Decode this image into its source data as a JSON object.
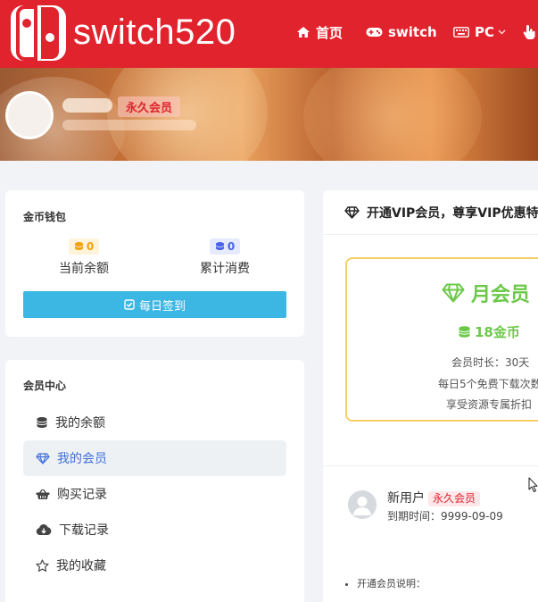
{
  "colors": {
    "brand": "#e1232e",
    "checkin": "#3cb6e3",
    "vip_green": "#6cc84a",
    "vip_border": "#f6cf64",
    "badge_red": "#e02330",
    "active_blue": "#3f6fd8"
  },
  "header": {
    "logo_text": "switch520",
    "nav": [
      {
        "label": "首页",
        "icon": "home-icon"
      },
      {
        "label": "switch",
        "icon": "gamepad-icon"
      },
      {
        "label": "PC",
        "icon": "keyboard-icon"
      }
    ]
  },
  "banner": {
    "badge": "永久会员"
  },
  "wallet": {
    "title": "金币钱包",
    "balance_value": "0",
    "balance_label": "当前余额",
    "spent_value": "0",
    "spent_label": "累计消费",
    "checkin_label": "每日签到"
  },
  "member_center": {
    "title": "会员中心",
    "items": [
      {
        "label": "我的余额",
        "icon": "coins-icon"
      },
      {
        "label": "我的会员",
        "icon": "diamond-icon"
      },
      {
        "label": "购买记录",
        "icon": "basket-icon"
      },
      {
        "label": "下载记录",
        "icon": "cloud-download-icon"
      },
      {
        "label": "我的收藏",
        "icon": "star-icon"
      }
    ]
  },
  "vip": {
    "heading": "开通VIP会员，尊享VIP优惠特",
    "plan": {
      "name": "月会员",
      "price": "18金币",
      "duration": "会员时长：30天",
      "downloads": "每日5个免费下载次数",
      "discount": "享受资源专属折扣"
    },
    "user": {
      "name": "新用户",
      "badge": "永久会员",
      "expiry": "到期时间：9999-09-09"
    },
    "notes_title": "开通会员说明："
  }
}
